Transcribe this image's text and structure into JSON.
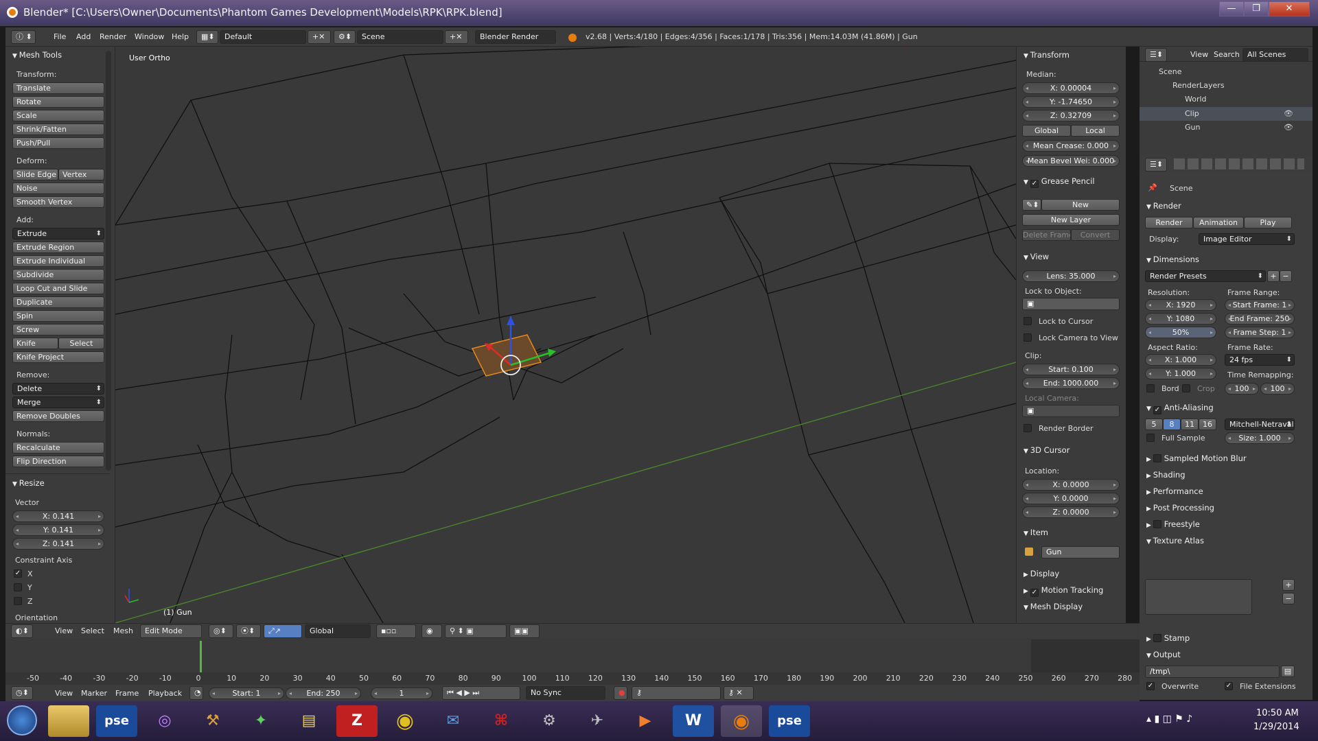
{
  "window": {
    "title": "Blender* [C:\\Users\\Owner\\Documents\\Phantom Games Development\\Models\\RPK\\RPK.blend]",
    "min": "—",
    "max": "❐",
    "close": "✕"
  },
  "info": {
    "menus": [
      "File",
      "Add",
      "Render",
      "Window",
      "Help"
    ],
    "layout": "Default",
    "scene": "Scene",
    "engine": "Blender Render",
    "stats": "v2.68 | Verts:4/180 | Edges:4/356 | Faces:1/178 | Tris:356 | Mem:14.03M (41.86M) | Gun"
  },
  "viewport": {
    "view_label": "User Ortho",
    "object_label": "(1) Gun"
  },
  "tools": {
    "title": "Mesh Tools",
    "transform_label": "Transform:",
    "transform": [
      "Translate",
      "Rotate",
      "Scale",
      "Shrink/Fatten",
      "Push/Pull"
    ],
    "deform_label": "Deform:",
    "slide_edge": "Slide Edge",
    "vertex": "Vertex",
    "noise": "Noise",
    "smooth_vertex": "Smooth Vertex",
    "add_label": "Add:",
    "extrude": "Extrude",
    "add": [
      "Extrude Region",
      "Extrude Individual",
      "Subdivide",
      "Loop Cut and Slide",
      "Duplicate",
      "Spin",
      "Screw"
    ],
    "knife": "Knife",
    "select": "Select",
    "knife_project": "Knife Project",
    "remove_label": "Remove:",
    "delete": "Delete",
    "merge": "Merge",
    "remove_doubles": "Remove Doubles",
    "normals_label": "Normals:",
    "recalculate": "Recalculate",
    "flip_direction": "Flip Direction"
  },
  "resize": {
    "title": "Resize",
    "vector_label": "Vector",
    "x": "X: 0.141",
    "y": "Y: 0.141",
    "z": "Z: 0.141",
    "constraint_label": "Constraint Axis",
    "cx": "X",
    "cy": "Y",
    "cz": "Z",
    "orientation": "Orientation"
  },
  "transform": {
    "title": "Transform",
    "median": "Median:",
    "x": "X: 0.00004",
    "y": "Y: -1.74650",
    "z": "Z: 0.32709",
    "global": "Global",
    "local": "Local",
    "crease": "Mean Crease: 0.000",
    "bevel": "Mean Bevel Wei: 0.000"
  },
  "grease": {
    "title": "Grease Pencil",
    "new": "New",
    "new_layer": "New Layer",
    "delete_frame": "Delete Frame",
    "convert": "Convert"
  },
  "view": {
    "title": "View",
    "lens": "Lens: 35.000",
    "lock_obj": "Lock to Object:",
    "lock_cursor": "Lock to Cursor",
    "lock_camera": "Lock Camera to View",
    "clip": "Clip:",
    "start": "Start: 0.100",
    "end": "End: 1000.000",
    "local_camera": "Local Camera:",
    "render_border": "Render Border"
  },
  "cursor": {
    "title": "3D Cursor",
    "location": "Location:",
    "x": "X: 0.0000",
    "y": "Y: 0.0000",
    "z": "Z: 0.0000"
  },
  "item": {
    "title": "Item",
    "name": "Gun"
  },
  "panels3d": {
    "display": "Display",
    "motion_tracking": "Motion Tracking",
    "mesh_display": "Mesh Display"
  },
  "outliner": {
    "view": "View",
    "search": "Search",
    "all_scenes": "All Scenes",
    "items": [
      "Scene",
      "RenderLayers",
      "World",
      "Clip",
      "Gun"
    ]
  },
  "render": {
    "scene": "Scene",
    "title": "Render",
    "render": "Render",
    "animation": "Animation",
    "play": "Play",
    "display_label": "Display:",
    "display": "Image Editor",
    "dimensions": "Dimensions",
    "presets": "Render Presets",
    "resolution": "Resolution:",
    "res_x": "X: 1920",
    "res_y": "Y: 1080",
    "res_pct": "50%",
    "frame_range": "Frame Range:",
    "start_frame": "Start Frame: 1",
    "end_frame": "End Frame: 250",
    "frame_step": "Frame Step: 1",
    "aspect": "Aspect Ratio:",
    "asp_x": "X: 1.000",
    "asp_y": "Y: 1.000",
    "frame_rate": "Frame Rate:",
    "fps": "24 fps",
    "time_remap": "Time Remapping:",
    "old": "100",
    "new": "100",
    "bord": "Bord",
    "crop": "Crop",
    "aa": "Anti-Aliasing",
    "samples": [
      "5",
      "8",
      "11",
      "16"
    ],
    "filter": "Mitchell-Netraval",
    "full_sample": "Full Sample",
    "size": "Size: 1.000",
    "motion_blur": "Sampled Motion Blur",
    "shading": "Shading",
    "performance": "Performance",
    "post": "Post Processing",
    "freestyle": "Freestyle",
    "atlas": "Texture Atlas",
    "stamp": "Stamp",
    "output": "Output",
    "path": "/tmp\\",
    "overwrite": "Overwrite",
    "file_ext": "File Extensions"
  },
  "viewhdr": {
    "view": "View",
    "select": "Select",
    "mesh": "Mesh",
    "mode": "Edit Mode",
    "orientation": "Global"
  },
  "timeline": {
    "ticks": [
      "-50",
      "-40",
      "-30",
      "-20",
      "-10",
      "0",
      "10",
      "20",
      "30",
      "40",
      "50",
      "60",
      "70",
      "80",
      "90",
      "100",
      "110",
      "120",
      "130",
      "140",
      "150",
      "160",
      "170",
      "180",
      "190",
      "200",
      "210",
      "220",
      "230",
      "240",
      "250",
      "260",
      "270",
      "280"
    ]
  },
  "timehdr": {
    "view": "View",
    "marker": "Marker",
    "frame": "Frame",
    "playback": "Playback",
    "start": "Start: 1",
    "end": "End: 250",
    "current": "1",
    "sync": "No Sync"
  },
  "taskbar": {
    "time": "10:50 AM",
    "date": "1/29/2014",
    "apps": [
      "pse",
      "pse"
    ]
  }
}
